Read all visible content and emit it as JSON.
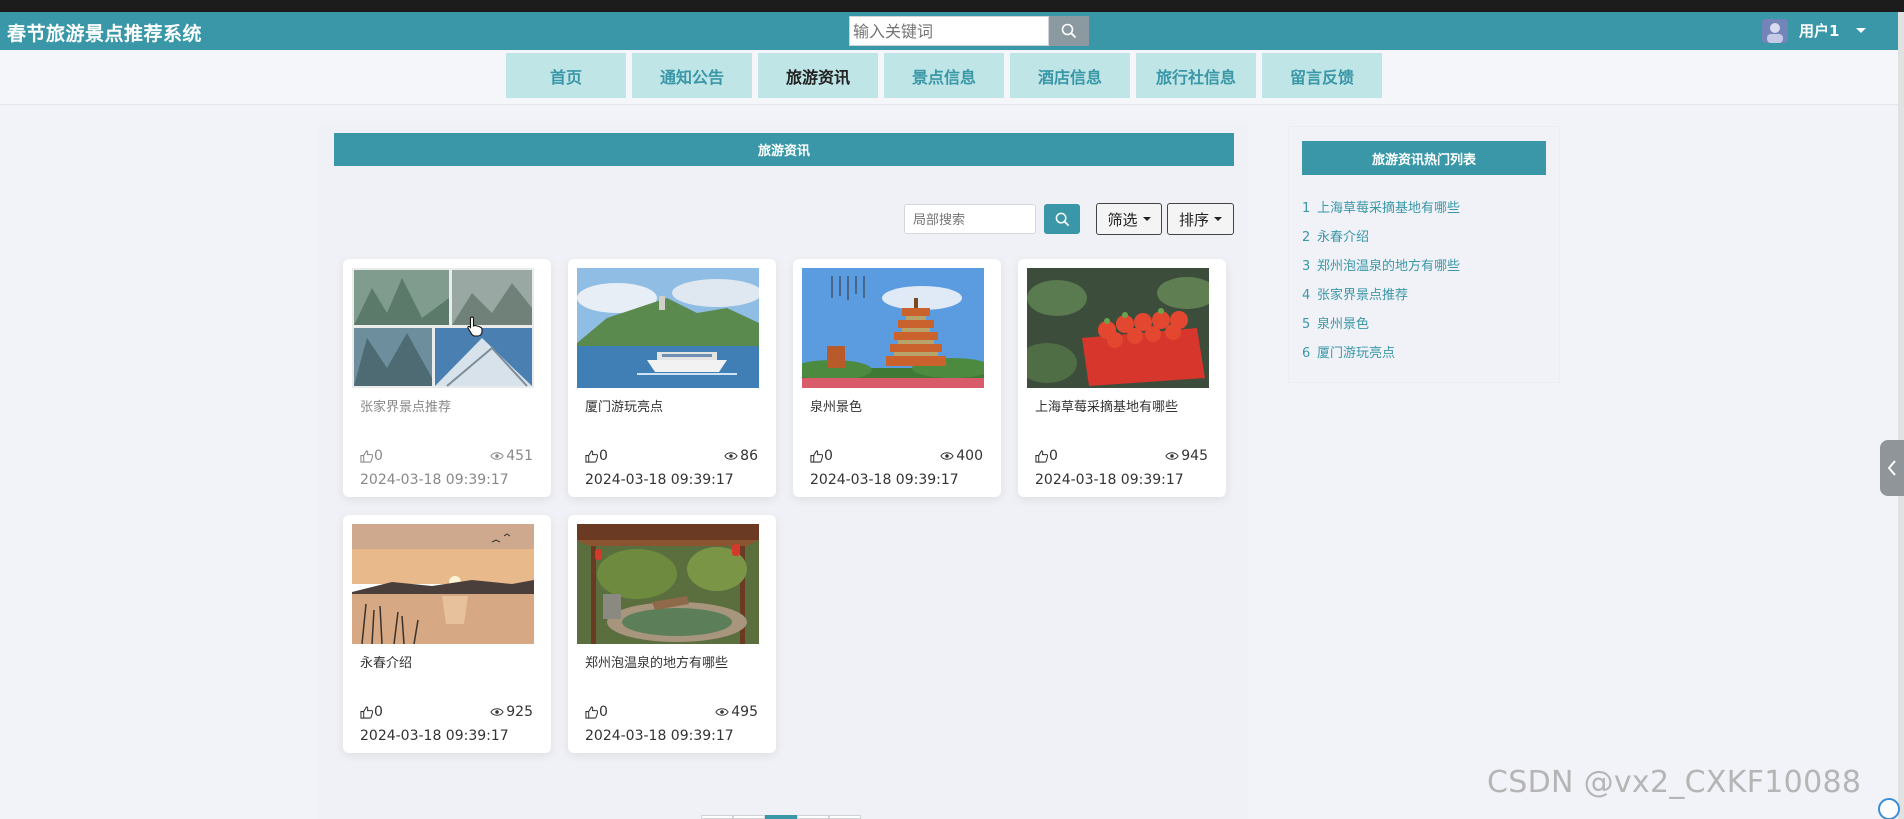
{
  "header": {
    "site_title": "春节旅游景点推荐系统",
    "search_placeholder": "输入关键词",
    "user_name": "用户1"
  },
  "nav": {
    "items": [
      {
        "label": "首页"
      },
      {
        "label": "通知公告"
      },
      {
        "label": "旅游资讯",
        "active": true
      },
      {
        "label": "景点信息"
      },
      {
        "label": "酒店信息"
      },
      {
        "label": "旅行社信息"
      },
      {
        "label": "留言反馈"
      }
    ]
  },
  "main": {
    "section_title": "旅游资讯",
    "local_search_placeholder": "局部搜索",
    "filter_label": "筛选",
    "sort_label": "排序",
    "cards": [
      {
        "title": "张家界景点推荐",
        "likes": "0",
        "views": "451",
        "date": "2024-03-18 09:39:17",
        "image": "zhangjiajie-collage"
      },
      {
        "title": "厦门游玩亮点",
        "likes": "0",
        "views": "86",
        "date": "2024-03-18 09:39:17",
        "image": "xiamen-ferry"
      },
      {
        "title": "泉州景色",
        "likes": "0",
        "views": "400",
        "date": "2024-03-18 09:39:17",
        "image": "quanzhou-pagoda"
      },
      {
        "title": "上海草莓采摘基地有哪些",
        "likes": "0",
        "views": "945",
        "date": "2024-03-18 09:39:17",
        "image": "strawberry-basket"
      },
      {
        "title": "永春介绍",
        "likes": "0",
        "views": "925",
        "date": "2024-03-18 09:39:17",
        "image": "sunset-lake"
      },
      {
        "title": "郑州泡温泉的地方有哪些",
        "likes": "0",
        "views": "495",
        "date": "2024-03-18 09:39:17",
        "image": "hot-spring-pavilion"
      }
    ]
  },
  "sidebar": {
    "title": "旅游资讯热门列表",
    "items": [
      {
        "num": "1",
        "label": "上海草莓采摘基地有哪些"
      },
      {
        "num": "2",
        "label": "永春介绍"
      },
      {
        "num": "3",
        "label": "郑州泡温泉的地方有哪些"
      },
      {
        "num": "4",
        "label": "张家界景点推荐"
      },
      {
        "num": "5",
        "label": "泉州景色"
      },
      {
        "num": "6",
        "label": "厦门游玩亮点"
      }
    ]
  },
  "watermark": "CSDN @vx2_CXKF10088",
  "colors": {
    "primary": "#3a97a8",
    "nav_bg": "#bfe5e7",
    "page_bg": "#f2f3f8"
  },
  "icons": {
    "search": "search-icon",
    "like": "thumbs-up-icon",
    "views": "eye-icon",
    "collapse": "chevron-left-icon"
  }
}
